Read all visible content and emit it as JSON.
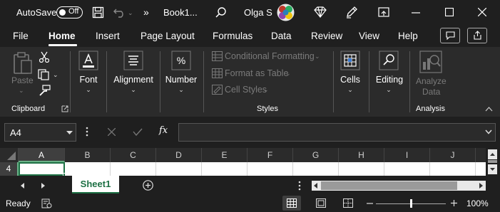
{
  "titlebar": {
    "autosave_label": "AutoSave",
    "autosave_state": "Off",
    "more_label": "»",
    "filename": "Book1...",
    "user_name": "Olga S"
  },
  "tabs": [
    {
      "label": "File",
      "active": false
    },
    {
      "label": "Home",
      "active": true
    },
    {
      "label": "Insert",
      "active": false
    },
    {
      "label": "Page Layout",
      "active": false
    },
    {
      "label": "Formulas",
      "active": false
    },
    {
      "label": "Data",
      "active": false
    },
    {
      "label": "Review",
      "active": false
    },
    {
      "label": "View",
      "active": false
    },
    {
      "label": "Help",
      "active": false
    }
  ],
  "ribbon": {
    "clipboard": {
      "paste_label": "Paste",
      "group_label": "Clipboard"
    },
    "font_label": "Font",
    "alignment_label": "Alignment",
    "number_label": "Number",
    "styles": {
      "conditional_formatting": "Conditional Formatting",
      "format_as_table": "Format as Table",
      "cell_styles": "Cell Styles",
      "group_label": "Styles"
    },
    "cells_label": "Cells",
    "editing_label": "Editing",
    "analysis": {
      "analyze_line1": "Analyze",
      "analyze_line2": "Data",
      "group_label": "Analysis"
    }
  },
  "formula_bar": {
    "name_box": "A4",
    "function_symbol": "fx",
    "formula_value": ""
  },
  "grid": {
    "columns": [
      "A",
      "B",
      "C",
      "D",
      "E",
      "F",
      "G",
      "H",
      "I",
      "J"
    ],
    "selected_column": "A",
    "row_number": "4"
  },
  "sheets": {
    "active": "Sheet1"
  },
  "status": {
    "ready": "Ready",
    "zoom": "100%"
  },
  "colors": {
    "accent_green": "#1e7145",
    "ribbon_bg": "#2b2b2b",
    "window_bg": "#1f1f1f"
  }
}
